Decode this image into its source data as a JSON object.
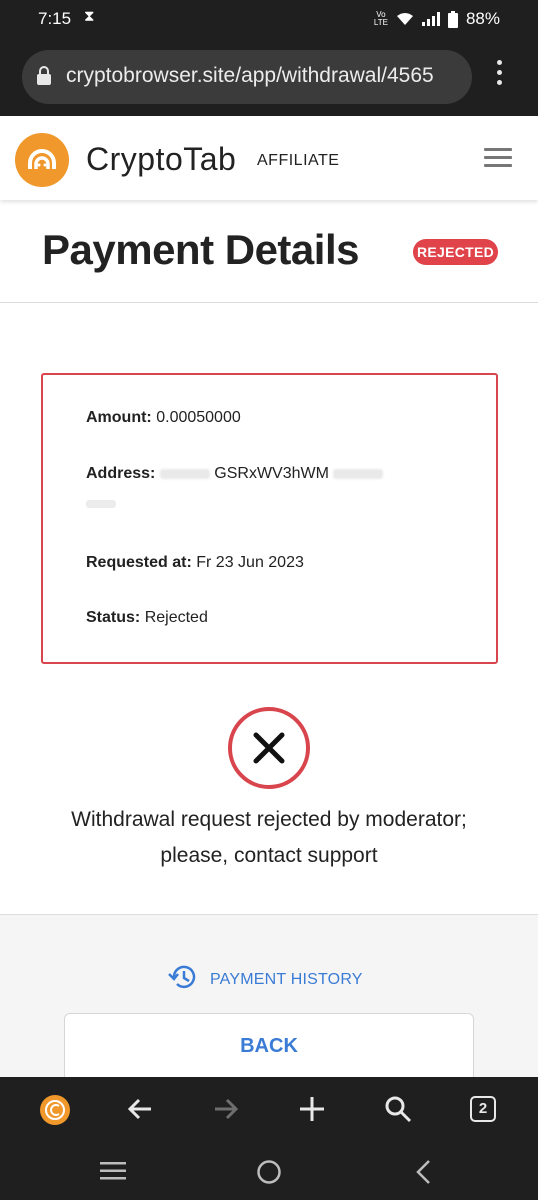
{
  "status_bar": {
    "time": "7:15",
    "hourglass_icon": "hourglass-icon",
    "volte": "LTE",
    "battery": "88%"
  },
  "browser": {
    "url": "cryptobrowser.site/app/withdrawal/4565",
    "tab_count": "2"
  },
  "header": {
    "brand": "CryptoTab",
    "brand_sub": "AFFILIATE"
  },
  "page": {
    "title": "Payment Details",
    "badge": "REJECTED"
  },
  "details": {
    "amount_label": "Amount:",
    "amount_value": "0.00050000",
    "address_label": "Address:",
    "address_value": "GSRxWV3hWM",
    "requested_label": "Requested at:",
    "requested_value": "Fr 23 Jun 2023",
    "status_label": "Status:",
    "status_value": "Rejected"
  },
  "message": {
    "line1": "Withdrawal request rejected by moderator;",
    "line2": "please, contact support"
  },
  "actions": {
    "history_label": "PAYMENT HISTORY",
    "back_label": "BACK"
  },
  "colors": {
    "accent_blue": "#3a7bd5",
    "reject_red": "#d9454c",
    "brand_orange": "#f0982b",
    "dark_chrome": "#1f1f1f"
  }
}
